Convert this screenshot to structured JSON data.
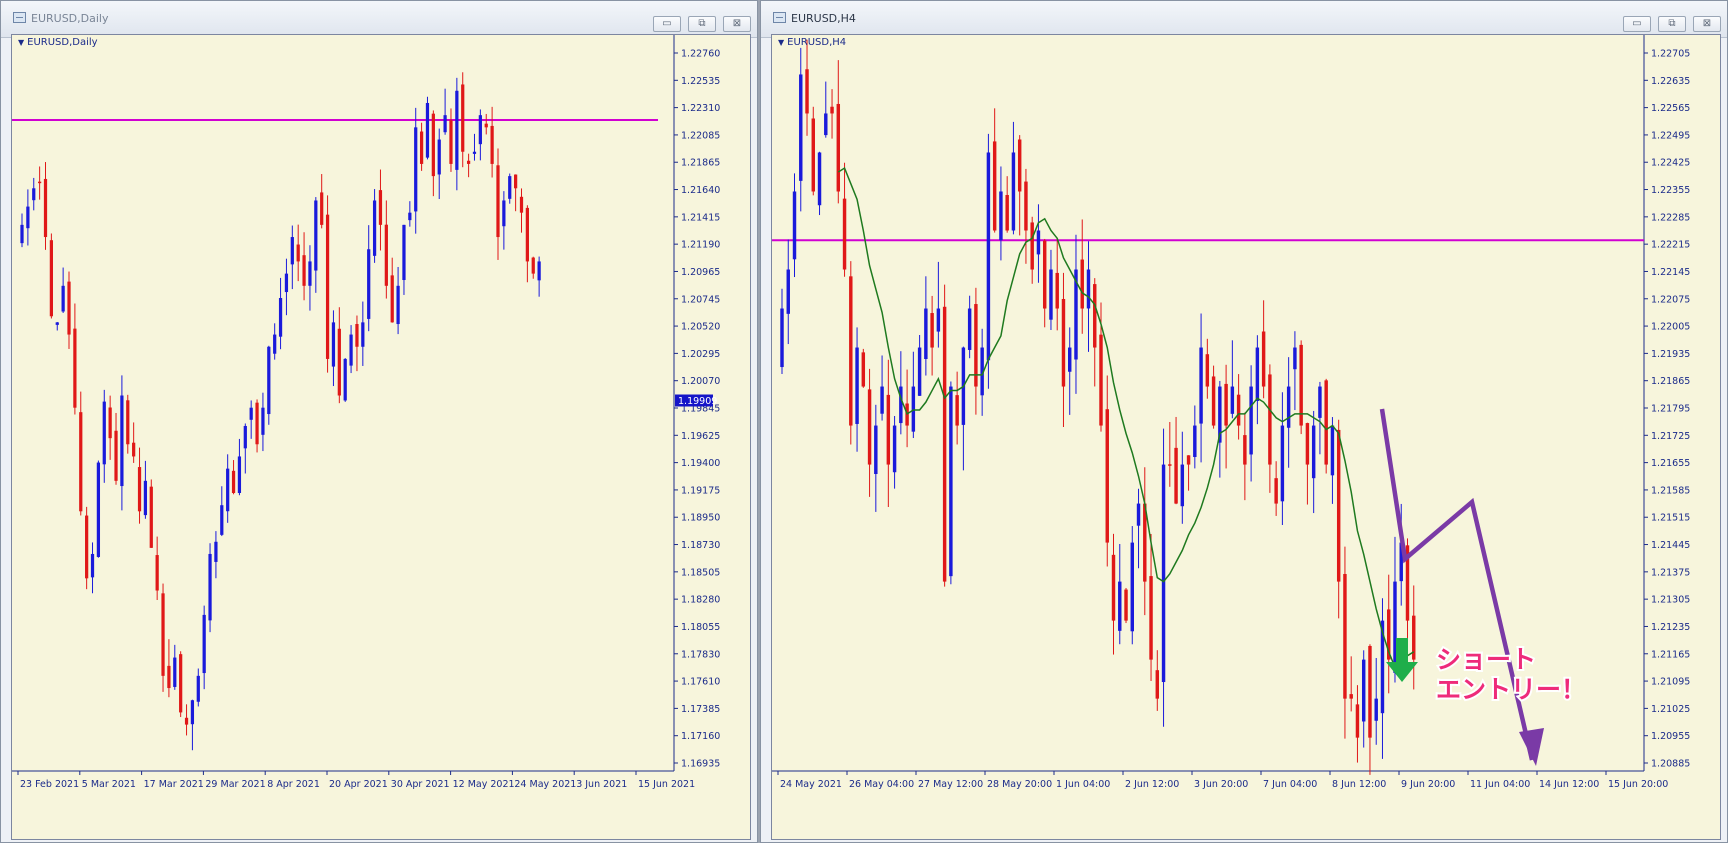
{
  "windows": [
    {
      "id": "daily",
      "title": "EURUSD,Daily",
      "symbol_label": "EURUSD,Daily",
      "controls": {
        "minimize": "▭",
        "restore": "⧉",
        "close": "⊠"
      },
      "chart_data": {
        "type": "candlestick",
        "symbol": "EURUSD",
        "timeframe": "Daily",
        "y_ticks": [
          "1.22760",
          "1.22535",
          "1.22310",
          "1.22085",
          "1.21865",
          "1.21640",
          "1.21415",
          "1.21190",
          "1.20965",
          "1.20745",
          "1.20520",
          "1.20295",
          "1.20070",
          "1.19845",
          "1.19625",
          "1.19400",
          "1.19175",
          "1.18950",
          "1.18730",
          "1.18505",
          "1.18280",
          "1.18055",
          "1.17830",
          "1.17610",
          "1.17385",
          "1.17160",
          "1.16935"
        ],
        "ylim": [
          1.16935,
          1.2276
        ],
        "current_price": "1.19909",
        "x_ticks": [
          "23 Feb 2021",
          "5 Mar 2021",
          "17 Mar 2021",
          "29 Mar 2021",
          "8 Apr 2021",
          "20 Apr 2021",
          "30 Apr 2021",
          "12 May 2021",
          "24 May 2021",
          "3 Jun 2021",
          "15 Jun 2021"
        ],
        "horizontal_line": {
          "price": 1.2221,
          "color": "#d100d1"
        },
        "up_color": "#1a1adb",
        "down_color": "#e01818",
        "closes": [
          1.2135,
          1.215,
          1.2165,
          1.217,
          1.2125,
          1.206,
          1.2055,
          1.2085,
          1.2045,
          1.1985,
          1.19,
          1.1845,
          1.1865,
          1.194,
          1.199,
          1.196,
          1.1925,
          1.1995,
          1.1955,
          1.1945,
          1.19,
          1.1925,
          1.187,
          1.1835,
          1.1765,
          1.1755,
          1.178,
          1.1735,
          1.1725,
          1.1745,
          1.1765,
          1.1815,
          1.1865,
          1.1875,
          1.1905,
          1.1935,
          1.1915,
          1.1945,
          1.197,
          1.1985,
          1.1955,
          1.1985,
          1.2035,
          1.2045,
          1.2075,
          1.2095,
          1.2125,
          1.2105,
          1.2085,
          1.2105,
          1.2155,
          1.2135,
          1.2025,
          1.2055,
          1.1995,
          1.2025,
          1.2045,
          1.2035,
          1.2055,
          1.2115,
          1.2155,
          1.2135,
          1.2085,
          1.2055,
          1.2085,
          1.2135,
          1.2145,
          1.2215,
          1.2185,
          1.2235,
          1.2175,
          1.2205,
          1.2225,
          1.2185,
          1.2245,
          1.2195,
          1.2185,
          1.2195,
          1.2225,
          1.2215,
          1.2185,
          1.2125,
          1.2155,
          1.2175,
          1.2165,
          1.2145,
          1.2105,
          1.2095,
          1.2105
        ]
      }
    },
    {
      "id": "h4",
      "title": "EURUSD,H4",
      "symbol_label": "EURUSD,H4",
      "controls": {
        "minimize": "▭",
        "restore": "⧉",
        "close": "⊠"
      },
      "chart_data": {
        "type": "candlestick",
        "symbol": "EURUSD",
        "timeframe": "H4",
        "y_ticks": [
          "1.22705",
          "1.22635",
          "1.22565",
          "1.22495",
          "1.22425",
          "1.22355",
          "1.22285",
          "1.22215",
          "1.22145",
          "1.22075",
          "1.22005",
          "1.21935",
          "1.21865",
          "1.21795",
          "1.21725",
          "1.21655",
          "1.21585",
          "1.21515",
          "1.21445",
          "1.21375",
          "1.21305",
          "1.21235",
          "1.21165",
          "1.21095",
          "1.21025",
          "1.20955",
          "1.20885"
        ],
        "ylim": [
          1.20885,
          1.22705
        ],
        "x_ticks": [
          "24 May 2021",
          "26 May 04:00",
          "27 May 12:00",
          "28 May 20:00",
          "1 Jun 04:00",
          "2 Jun 12:00",
          "3 Jun 20:00",
          "7 Jun 04:00",
          "8 Jun 12:00",
          "9 Jun 20:00",
          "11 Jun 04:00",
          "14 Jun 12:00",
          "15 Jun 20:00"
        ],
        "horizontal_line": {
          "price": 1.22225,
          "color": "#d100d1"
        },
        "moving_average_color": "#1f7a1f",
        "up_color": "#1a1adb",
        "down_color": "#e01818",
        "closes": [
          1.2205,
          1.2215,
          1.2235,
          1.2265,
          1.2255,
          1.2235,
          1.2245,
          1.2255,
          1.2255,
          1.2235,
          1.2215,
          1.2175,
          1.2195,
          1.2185,
          1.2165,
          1.2175,
          1.2185,
          1.2165,
          1.2175,
          1.2185,
          1.2175,
          1.2185,
          1.2195,
          1.2205,
          1.2195,
          1.2205,
          1.2135,
          1.2185,
          1.2175,
          1.2195,
          1.2205,
          1.2185,
          1.2195,
          1.2245,
          1.2225,
          1.2235,
          1.2225,
          1.2245,
          1.2235,
          1.2225,
          1.2215,
          1.2225,
          1.2205,
          1.2215,
          1.2205,
          1.2185,
          1.2195,
          1.2215,
          1.2205,
          1.2215,
          1.2195,
          1.2175,
          1.2145,
          1.2125,
          1.2135,
          1.2125,
          1.2145,
          1.2155,
          1.2135,
          1.2115,
          1.2105,
          1.2165,
          1.2165,
          1.2155,
          1.2165,
          1.2165,
          1.2175,
          1.2195,
          1.2185,
          1.2175,
          1.2185,
          1.2175,
          1.2185,
          1.2175,
          1.2165,
          1.2185,
          1.2195,
          1.2185,
          1.2165,
          1.2155,
          1.2175,
          1.2185,
          1.2195,
          1.2175,
          1.2165,
          1.2175,
          1.2185,
          1.2165,
          1.2175,
          1.2135,
          1.2105,
          1.2105,
          1.2095,
          1.2115,
          1.2095,
          1.2105,
          1.2125,
          1.2115,
          1.2135,
          1.2145,
          1.2125,
          1.2115
        ],
        "trend_path": [
          [
            610,
            374
          ],
          [
            633,
            524
          ],
          [
            700,
            467
          ],
          [
            760,
            725
          ]
        ],
        "annotation_text": [
          "ショート",
          "エントリー！"
        ],
        "entry_arrow_color": "#1fae4a",
        "annotation_color": "#ee2b7a"
      }
    }
  ]
}
